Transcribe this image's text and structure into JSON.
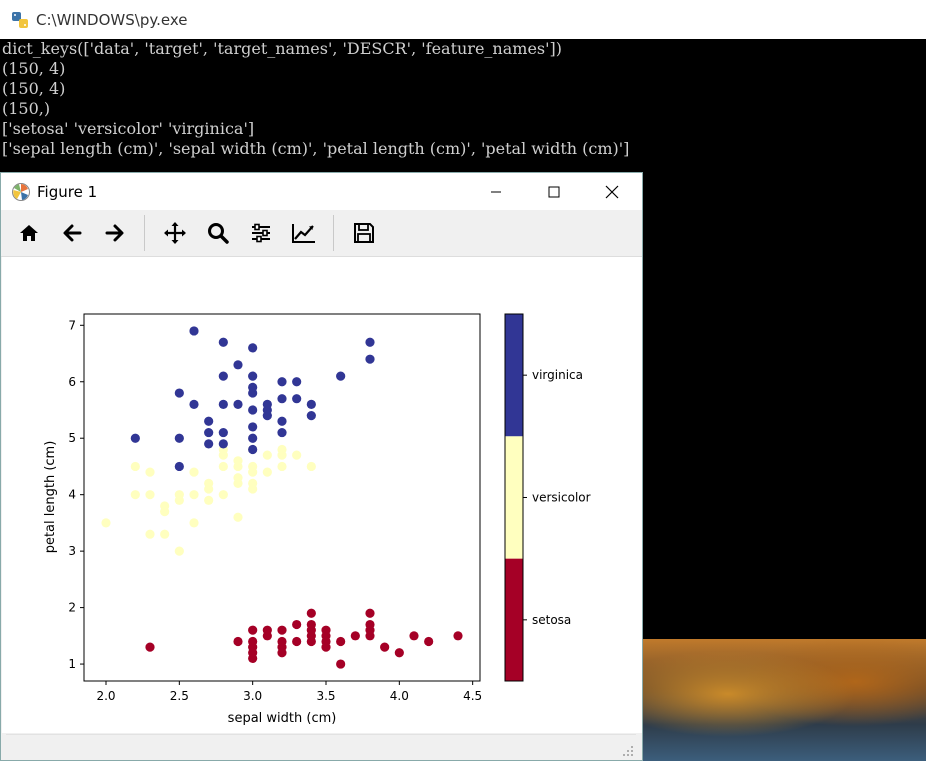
{
  "console_window": {
    "title": "C:\\WINDOWS\\py.exe",
    "lines": [
      "dict_keys(['data', 'target', 'target_names', 'DESCR', 'feature_names'])",
      "(150, 4)",
      "(150, 4)",
      "(150,)",
      "['setosa' 'versicolor' 'virginica']",
      "['sepal length (cm)', 'sepal width (cm)', 'petal length (cm)', 'petal width (cm)']"
    ]
  },
  "figure_window": {
    "title": "Figure 1",
    "toolbar": [
      "home-icon",
      "back-arrow-icon",
      "forward-arrow-icon",
      "pan-icon",
      "zoom-icon",
      "subplots-icon",
      "customize-icon",
      "save-icon"
    ]
  },
  "colors": {
    "setosa": "#a50026",
    "versicolor": "#ffffbf",
    "virginica": "#313695"
  },
  "chart_data": {
    "type": "scatter",
    "xlabel": "sepal width (cm)",
    "ylabel": "petal length (cm)",
    "xlim": [
      1.85,
      4.55
    ],
    "ylim": [
      0.7,
      7.2
    ],
    "xticks": [
      "2.0",
      "2.5",
      "3.0",
      "3.5",
      "4.0",
      "4.5"
    ],
    "yticks": [
      "1",
      "2",
      "3",
      "4",
      "5",
      "6",
      "7"
    ],
    "colorbar_labels": [
      "setosa",
      "versicolor",
      "virginica"
    ],
    "series": [
      {
        "name": "setosa",
        "points": [
          [
            2.3,
            1.3
          ],
          [
            2.9,
            1.4
          ],
          [
            3.0,
            1.1
          ],
          [
            3.0,
            1.2
          ],
          [
            3.0,
            1.3
          ],
          [
            3.0,
            1.4
          ],
          [
            3.0,
            1.6
          ],
          [
            3.1,
            1.5
          ],
          [
            3.1,
            1.6
          ],
          [
            3.2,
            1.2
          ],
          [
            3.2,
            1.3
          ],
          [
            3.2,
            1.4
          ],
          [
            3.2,
            1.6
          ],
          [
            3.3,
            1.4
          ],
          [
            3.3,
            1.7
          ],
          [
            3.4,
            1.4
          ],
          [
            3.4,
            1.5
          ],
          [
            3.4,
            1.6
          ],
          [
            3.4,
            1.7
          ],
          [
            3.4,
            1.9
          ],
          [
            3.5,
            1.3
          ],
          [
            3.5,
            1.4
          ],
          [
            3.5,
            1.5
          ],
          [
            3.5,
            1.6
          ],
          [
            3.6,
            1.0
          ],
          [
            3.6,
            1.4
          ],
          [
            3.7,
            1.5
          ],
          [
            3.8,
            1.5
          ],
          [
            3.8,
            1.6
          ],
          [
            3.8,
            1.7
          ],
          [
            3.8,
            1.9
          ],
          [
            3.9,
            1.3
          ],
          [
            4.0,
            1.2
          ],
          [
            4.1,
            1.5
          ],
          [
            4.2,
            1.4
          ],
          [
            4.4,
            1.5
          ]
        ]
      },
      {
        "name": "versicolor",
        "points": [
          [
            2.0,
            3.5
          ],
          [
            2.2,
            4.0
          ],
          [
            2.2,
            4.5
          ],
          [
            2.3,
            3.3
          ],
          [
            2.3,
            4.0
          ],
          [
            2.3,
            4.4
          ],
          [
            2.4,
            3.3
          ],
          [
            2.4,
            3.7
          ],
          [
            2.4,
            3.8
          ],
          [
            2.5,
            3.0
          ],
          [
            2.5,
            3.9
          ],
          [
            2.5,
            4.0
          ],
          [
            2.6,
            3.5
          ],
          [
            2.6,
            4.0
          ],
          [
            2.6,
            4.4
          ],
          [
            2.7,
            3.9
          ],
          [
            2.7,
            4.1
          ],
          [
            2.7,
            4.2
          ],
          [
            2.8,
            4.0
          ],
          [
            2.8,
            4.5
          ],
          [
            2.8,
            4.7
          ],
          [
            2.8,
            4.8
          ],
          [
            2.9,
            3.6
          ],
          [
            2.9,
            4.2
          ],
          [
            2.9,
            4.3
          ],
          [
            2.9,
            4.5
          ],
          [
            2.9,
            4.6
          ],
          [
            3.0,
            4.1
          ],
          [
            3.0,
            4.2
          ],
          [
            3.0,
            4.4
          ],
          [
            3.0,
            4.5
          ],
          [
            3.0,
            4.8
          ],
          [
            3.1,
            4.4
          ],
          [
            3.1,
            4.7
          ],
          [
            3.2,
            4.5
          ],
          [
            3.2,
            4.7
          ],
          [
            3.2,
            4.8
          ],
          [
            3.3,
            4.7
          ],
          [
            3.4,
            4.5
          ]
        ]
      },
      {
        "name": "virginica",
        "points": [
          [
            2.2,
            5.0
          ],
          [
            2.5,
            4.5
          ],
          [
            2.5,
            5.0
          ],
          [
            2.5,
            5.8
          ],
          [
            2.6,
            5.6
          ],
          [
            2.6,
            6.9
          ],
          [
            2.7,
            4.9
          ],
          [
            2.7,
            5.1
          ],
          [
            2.7,
            5.3
          ],
          [
            2.8,
            4.9
          ],
          [
            2.8,
            5.1
          ],
          [
            2.8,
            5.6
          ],
          [
            2.8,
            6.1
          ],
          [
            2.8,
            6.7
          ],
          [
            2.9,
            5.6
          ],
          [
            2.9,
            6.3
          ],
          [
            3.0,
            4.8
          ],
          [
            3.0,
            5.0
          ],
          [
            3.0,
            5.2
          ],
          [
            3.0,
            5.5
          ],
          [
            3.0,
            5.8
          ],
          [
            3.0,
            5.9
          ],
          [
            3.0,
            6.1
          ],
          [
            3.0,
            6.6
          ],
          [
            3.1,
            5.4
          ],
          [
            3.1,
            5.5
          ],
          [
            3.1,
            5.6
          ],
          [
            3.2,
            5.1
          ],
          [
            3.2,
            5.3
          ],
          [
            3.2,
            5.7
          ],
          [
            3.2,
            6.0
          ],
          [
            3.3,
            5.7
          ],
          [
            3.3,
            6.0
          ],
          [
            3.4,
            5.4
          ],
          [
            3.4,
            5.6
          ],
          [
            3.6,
            6.1
          ],
          [
            3.8,
            6.4
          ],
          [
            3.8,
            6.7
          ]
        ]
      }
    ]
  }
}
